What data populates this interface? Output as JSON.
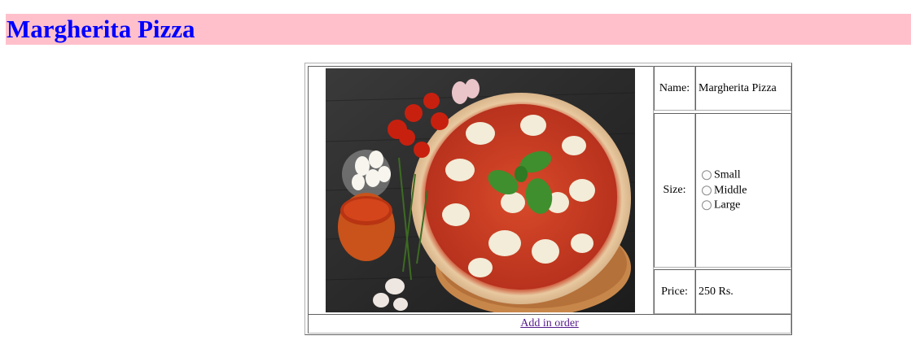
{
  "header": {
    "title": "Margherita Pizza"
  },
  "product": {
    "image": {
      "icon": "pizza-image",
      "alt": "Margherita Pizza"
    },
    "name_label": "Name:",
    "name_value": "Margherita Pizza",
    "size_label": "Size:",
    "sizes": [
      "Small",
      "Middle",
      "Large"
    ],
    "price_label": "Price:",
    "price_value": "250 Rs.",
    "action_label": "Add in order"
  },
  "colors": {
    "header_bg": "#ffc0cb",
    "title_color": "#0000ff",
    "link_color": "#551a8b"
  }
}
